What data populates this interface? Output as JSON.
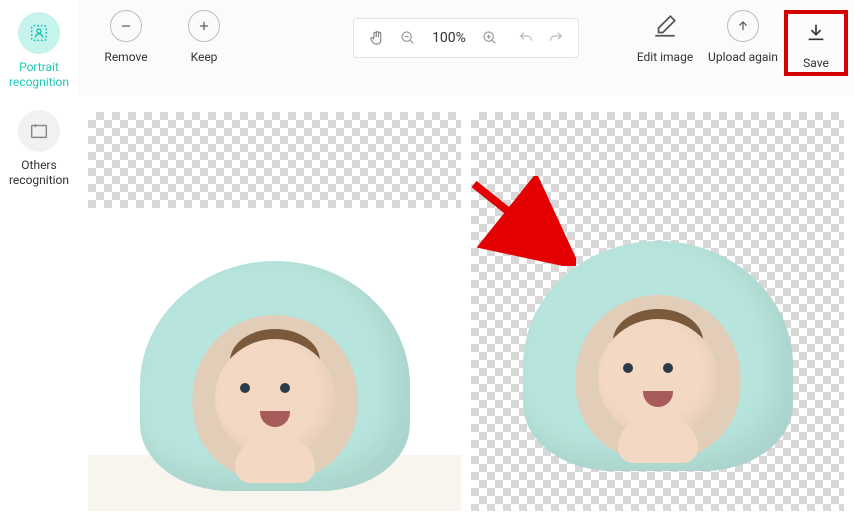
{
  "sidebar": {
    "items": [
      {
        "id": "portrait",
        "label": "Portrait\nrecognition",
        "active": true
      },
      {
        "id": "others",
        "label": "Others\nrecognition",
        "active": false
      }
    ]
  },
  "toolbar": {
    "remove_label": "Remove",
    "keep_label": "Keep",
    "edit_label": "Edit image",
    "upload_label": "Upload again",
    "save_label": "Save"
  },
  "zoom": {
    "value": "100%"
  },
  "colors": {
    "accent": "#1fc7b6",
    "highlight": "#d40000"
  },
  "icons": {
    "portrait": "portrait-icon",
    "others": "sparkle-icon",
    "remove": "minus-icon",
    "keep": "plus-icon",
    "hand": "hand-icon",
    "zoom_out": "zoom-out-icon",
    "zoom_in": "zoom-in-icon",
    "undo": "undo-icon",
    "redo": "redo-icon",
    "edit": "eraser-icon",
    "upload": "upload-icon",
    "save": "download-icon"
  }
}
